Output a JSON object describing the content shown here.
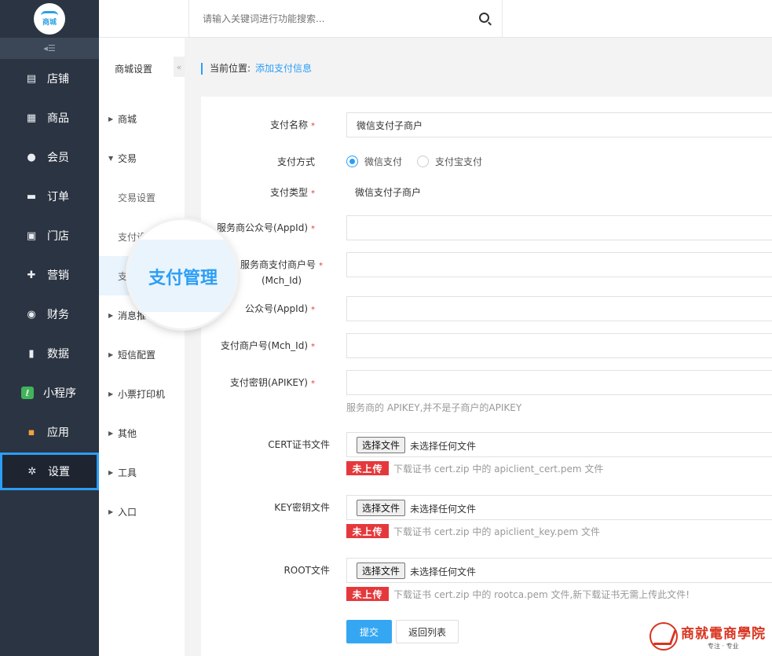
{
  "logo": {
    "text": "商城"
  },
  "leftnav": {
    "collapse_glyph": "◂☰",
    "items": [
      {
        "label": "店铺",
        "icon": "store-icon",
        "glyph": "▤"
      },
      {
        "label": "商品",
        "icon": "goods-icon",
        "glyph": "▦"
      },
      {
        "label": "会员",
        "icon": "member-icon",
        "glyph": "●"
      },
      {
        "label": "订单",
        "icon": "order-icon",
        "glyph": "▬"
      },
      {
        "label": "门店",
        "icon": "branch-store-icon",
        "glyph": "▣"
      },
      {
        "label": "营销",
        "icon": "gift-icon",
        "glyph": "✚"
      },
      {
        "label": "财务",
        "icon": "money-bag-icon",
        "glyph": "◉"
      },
      {
        "label": "数据",
        "icon": "bar-chart-icon",
        "glyph": "▮"
      },
      {
        "label": "小程序",
        "icon": "mini-program-icon",
        "glyph": "ℓ"
      },
      {
        "label": "应用",
        "icon": "apps-grid-icon",
        "glyph": "▪"
      },
      {
        "label": "设置",
        "icon": "gear-icon",
        "glyph": "✲"
      }
    ]
  },
  "subnav": {
    "title": "商城设置",
    "collapse_glyph": "«",
    "items": [
      {
        "label": "商城",
        "arrow": "▶"
      },
      {
        "label": "交易",
        "arrow": "▼"
      },
      {
        "label": "交易设置",
        "arrow": ""
      },
      {
        "label": "支付设",
        "arrow": ""
      },
      {
        "label": "支",
        "arrow": ""
      },
      {
        "label": "消息推",
        "arrow": "▶"
      },
      {
        "label": "短信配置",
        "arrow": "▶"
      },
      {
        "label": "小票打印机",
        "arrow": "▶"
      },
      {
        "label": "其他",
        "arrow": "▶"
      },
      {
        "label": "工具",
        "arrow": "▶"
      },
      {
        "label": "入口",
        "arrow": "▶"
      }
    ]
  },
  "topbar": {
    "home_glyph": "⌂",
    "menu_glyph": "≡",
    "search_placeholder": "请输入关键词进行功能搜索..."
  },
  "breadcrumb": {
    "label": "当前位置:",
    "current": "添加支付信息"
  },
  "form": {
    "pay_name_label": "支付名称",
    "pay_name_value": "微信支付子商户",
    "pay_method_label": "支付方式",
    "pay_method_options": [
      "微信支付",
      "支付宝支付"
    ],
    "pay_method_selected": "微信支付",
    "pay_type_label": "支付类型",
    "pay_type_value": "微信支付子商户",
    "sp_appid_label": "服务商公众号(AppId)",
    "sp_mchid_label_1": "服务商支付商户号",
    "sp_mchid_label_2": "(Mch_Id)",
    "appid_label": "公众号(AppId)",
    "mchid_label": "支付商户号(Mch_Id)",
    "apikey_label": "支付密钥(APIKEY)",
    "apikey_hint": "服务商的 APIKEY,并不是子商户的APIKEY",
    "required_mark": "*",
    "file_button": "选择文件",
    "file_none": "未选择任何文件",
    "not_uploaded": "未上传",
    "cert_label": "CERT证书文件",
    "cert_hint": "下载证书 cert.zip 中的 apiclient_cert.pem 文件",
    "key_label": "KEY密钥文件",
    "key_hint": "下载证书 cert.zip 中的 apiclient_key.pem 文件",
    "root_label": "ROOT文件",
    "root_hint": "下载证书 cert.zip 中的 rootca.pem 文件,新下载证书无需上传此文件!",
    "submit": "提交",
    "back": "返回列表"
  },
  "magnifier": {
    "text": "支付管理"
  },
  "watermark": {
    "title": "商就電商學院",
    "slogan": "专注 · 专业"
  },
  "colors": {
    "accent": "#2c9ef5",
    "nav_bg": "#2b3442",
    "danger": "#e4393c"
  }
}
